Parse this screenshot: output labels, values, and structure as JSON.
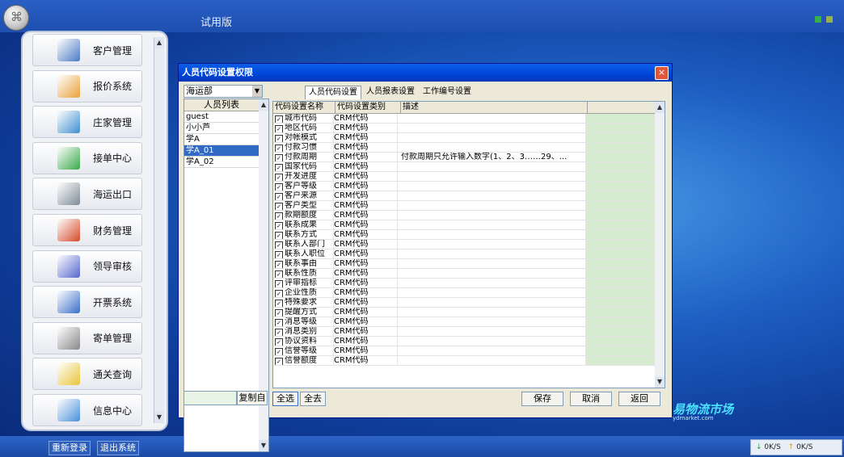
{
  "app": {
    "trial_label": "试用版"
  },
  "menu": {
    "items": [
      {
        "label": "客户管理",
        "icon": "customer-icon",
        "color": "#4a7cc4"
      },
      {
        "label": "报价系统",
        "icon": "quote-icon",
        "color": "#e8a23a"
      },
      {
        "label": "庄家管理",
        "icon": "pen-icon",
        "color": "#3f8fcf"
      },
      {
        "label": "接单中心",
        "icon": "order-icon",
        "color": "#3aa84a"
      },
      {
        "label": "海运出口",
        "icon": "gear-icon",
        "color": "#7f8c99"
      },
      {
        "label": "财务管理",
        "icon": "finance-icon",
        "color": "#d44a2a"
      },
      {
        "label": "领导审核",
        "icon": "review-icon",
        "color": "#5566cc"
      },
      {
        "label": "开票系统",
        "icon": "invoice-icon",
        "color": "#3a6ec9"
      },
      {
        "label": "寄单管理",
        "icon": "mail-icon",
        "color": "#888888"
      },
      {
        "label": "通关查询",
        "icon": "customs-icon",
        "color": "#e8c43a"
      },
      {
        "label": "信息中心",
        "icon": "info-icon",
        "color": "#4a90d9"
      }
    ]
  },
  "bottom": {
    "relogin": "重新登录",
    "exit": "退出系统",
    "net_down": "0K/S",
    "net_up": "0K/S"
  },
  "brand": {
    "name": "易物流市场",
    "sub": "ydmarket.com"
  },
  "dialog": {
    "title": "人员代码设置权限",
    "close": "×",
    "dept": "海运部",
    "users_header": "人员列表",
    "users": [
      "guest",
      "小小芦",
      "学A",
      "学A_01",
      "学A_02"
    ],
    "selected_user": "学A_01",
    "copy_btn": "复制自",
    "tabs": [
      "人员代码设置",
      "人员报表设置",
      "工作编号设置"
    ],
    "grid": {
      "headers": [
        "代码设置名称",
        "代码设置类别",
        "描述",
        ""
      ],
      "rows": [
        {
          "name": "城市代码",
          "type": "CRM代码",
          "desc": ""
        },
        {
          "name": "地区代码",
          "type": "CRM代码",
          "desc": ""
        },
        {
          "name": "对帐模式",
          "type": "CRM代码",
          "desc": ""
        },
        {
          "name": "付款习惯",
          "type": "CRM代码",
          "desc": ""
        },
        {
          "name": "付款周期",
          "type": "CRM代码",
          "desc": "付款周期只允许输入数字(1、2、3……29、..."
        },
        {
          "name": "国家代码",
          "type": "CRM代码",
          "desc": ""
        },
        {
          "name": "开发进度",
          "type": "CRM代码",
          "desc": ""
        },
        {
          "name": "客户等级",
          "type": "CRM代码",
          "desc": ""
        },
        {
          "name": "客户来源",
          "type": "CRM代码",
          "desc": ""
        },
        {
          "name": "客户类型",
          "type": "CRM代码",
          "desc": ""
        },
        {
          "name": "款期额度",
          "type": "CRM代码",
          "desc": ""
        },
        {
          "name": "联系成果",
          "type": "CRM代码",
          "desc": ""
        },
        {
          "name": "联系方式",
          "type": "CRM代码",
          "desc": ""
        },
        {
          "name": "联系人部门",
          "type": "CRM代码",
          "desc": ""
        },
        {
          "name": "联系人职位",
          "type": "CRM代码",
          "desc": ""
        },
        {
          "name": "联系事由",
          "type": "CRM代码",
          "desc": ""
        },
        {
          "name": "联系性质",
          "type": "CRM代码",
          "desc": ""
        },
        {
          "name": "评审指标",
          "type": "CRM代码",
          "desc": ""
        },
        {
          "name": "企业性质",
          "type": "CRM代码",
          "desc": ""
        },
        {
          "name": "特殊要求",
          "type": "CRM代码",
          "desc": ""
        },
        {
          "name": "提醒方式",
          "type": "CRM代码",
          "desc": ""
        },
        {
          "name": "消息等级",
          "type": "CRM代码",
          "desc": ""
        },
        {
          "name": "消息类别",
          "type": "CRM代码",
          "desc": ""
        },
        {
          "name": "协议资料",
          "type": "CRM代码",
          "desc": ""
        },
        {
          "name": "信誉等级",
          "type": "CRM代码",
          "desc": ""
        },
        {
          "name": "信誉额度",
          "type": "CRM代码",
          "desc": ""
        }
      ]
    },
    "buttons": {
      "select_all": "全选",
      "deselect_all": "全去",
      "save": "保存",
      "cancel": "取消",
      "back": "返回"
    }
  }
}
